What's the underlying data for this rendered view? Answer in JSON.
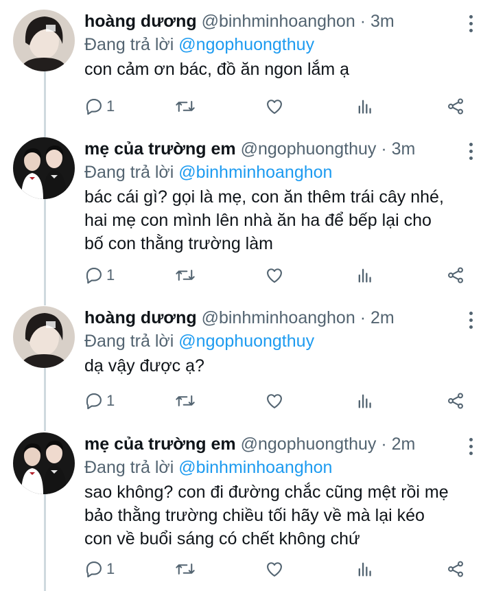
{
  "colors": {
    "name": "#0f1419",
    "muted": "#536471",
    "link": "#1d9bf0",
    "thread_line": "#cfd9de"
  },
  "icons": [
    "reply-icon",
    "retweet-icon",
    "like-icon",
    "analytics-icon",
    "share-icon",
    "more-icon"
  ],
  "tweets": [
    {
      "display_name": "hoàng dương",
      "handle": "@binhminhoanghon",
      "dot": "·",
      "time": "3m",
      "replying_prefix": "Đang trả lời",
      "replying_to": "@ngophuongthuy",
      "text": "con cảm ơn bác, đồ ăn ngon lắm ạ",
      "reply_count": "1"
    },
    {
      "display_name": "mẹ của trường em",
      "handle": "@ngophuongthuy",
      "dot": "·",
      "time": "3m",
      "replying_prefix": "Đang trả lời",
      "replying_to": "@binhminhoanghon",
      "text": "bác cái gì? gọi là mẹ, con ăn thêm trái cây nhé,\nhai mẹ con mình lên nhà ăn ha để bếp lại cho\nbố con thằng trường làm",
      "reply_count": "1"
    },
    {
      "display_name": "hoàng dương",
      "handle": "@binhminhoanghon",
      "dot": "·",
      "time": "2m",
      "replying_prefix": "Đang trả lời",
      "replying_to": "@ngophuongthuy",
      "text": "dạ vậy được ạ?",
      "reply_count": "1"
    },
    {
      "display_name": "mẹ của trường em",
      "handle": "@ngophuongthuy",
      "dot": "·",
      "time": "2m",
      "replying_prefix": "Đang trả lời",
      "replying_to": "@binhminhoanghon",
      "text": "sao không? con đi đường chắc cũng mệt rồi mẹ\nbảo thằng trường chiều tối hãy về mà lại kéo\ncon về buổi sáng có chết không chứ",
      "reply_count": "1"
    }
  ]
}
